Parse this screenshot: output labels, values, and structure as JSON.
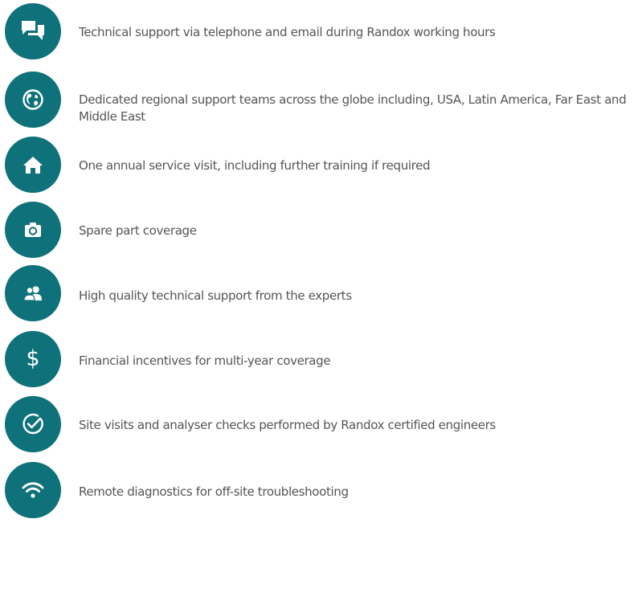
{
  "accent_color": "#0f7179",
  "text_color": "#555555",
  "features": [
    {
      "icon": "chat-bubbles-icon",
      "text": "Technical support via telephone and email during Randox working hours"
    },
    {
      "icon": "globe-icon",
      "text": "Dedicated regional support teams across the globe including, USA, Latin America, Far East and Middle East"
    },
    {
      "icon": "home-icon",
      "text": "One annual service visit, including further training if required"
    },
    {
      "icon": "camera-icon",
      "text": "Spare part coverage"
    },
    {
      "icon": "people-icon",
      "text": "High quality technical support from the experts"
    },
    {
      "icon": "dollar-icon",
      "glyph": "$",
      "text": "Financial incentives for multi-year coverage"
    },
    {
      "icon": "check-circle-icon",
      "text": "Site visits and analyser checks performed by Randox certified engineers"
    },
    {
      "icon": "wifi-icon",
      "text": "Remote diagnostics for off-site troubleshooting"
    }
  ]
}
